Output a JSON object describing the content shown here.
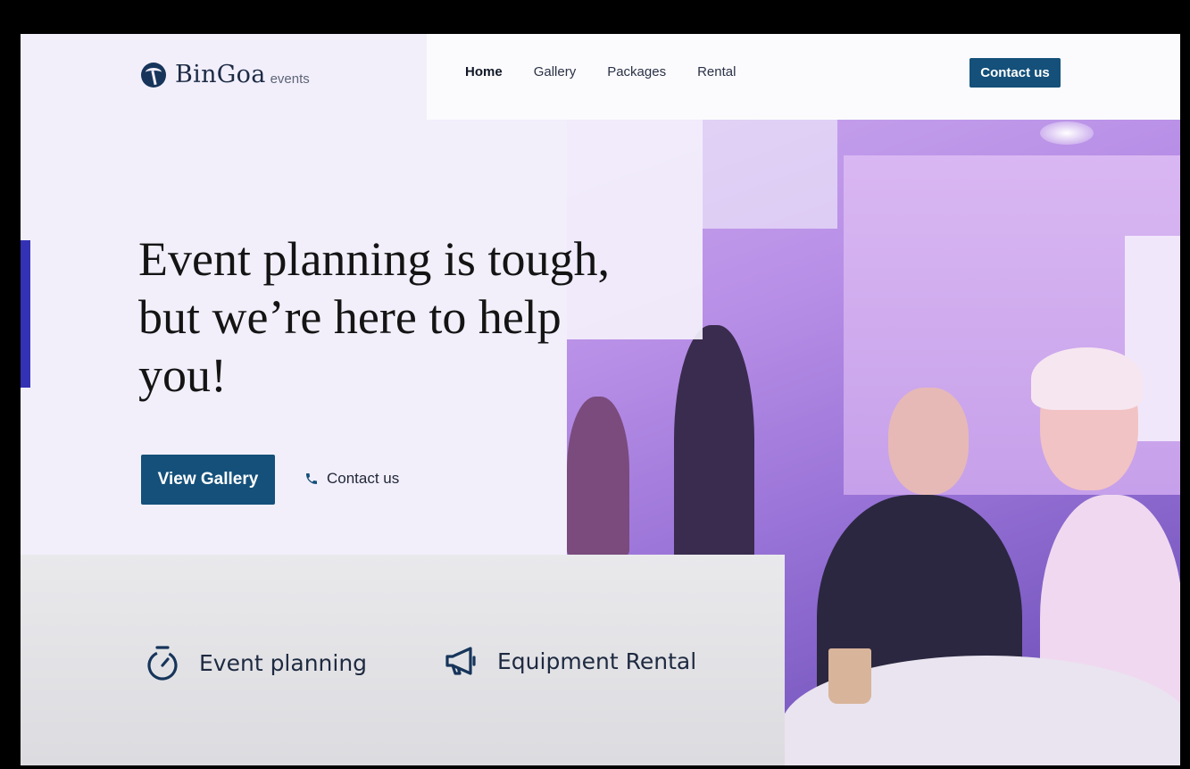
{
  "brand": {
    "name": "BinGoa",
    "sub": "events"
  },
  "nav": {
    "items": [
      {
        "label": "Home",
        "active": true
      },
      {
        "label": "Gallery",
        "active": false
      },
      {
        "label": "Packages",
        "active": false
      },
      {
        "label": "Rental",
        "active": false
      }
    ],
    "cta_label": "Contact us"
  },
  "hero": {
    "title_lines": [
      "Event planning is tough,",
      "but we’re here to help",
      "you!"
    ],
    "primary_button": "View Gallery",
    "secondary_link": "Contact us",
    "secondary_icon": "phone-icon"
  },
  "services": [
    {
      "label": "Event planning",
      "icon": "stopwatch-icon"
    },
    {
      "label": "Equipment Rental",
      "icon": "megaphone-icon"
    }
  ],
  "colors": {
    "primary": "#14507a",
    "accent": "#3432b4",
    "text_dark": "#141414",
    "page_bg": "#f2effb"
  }
}
